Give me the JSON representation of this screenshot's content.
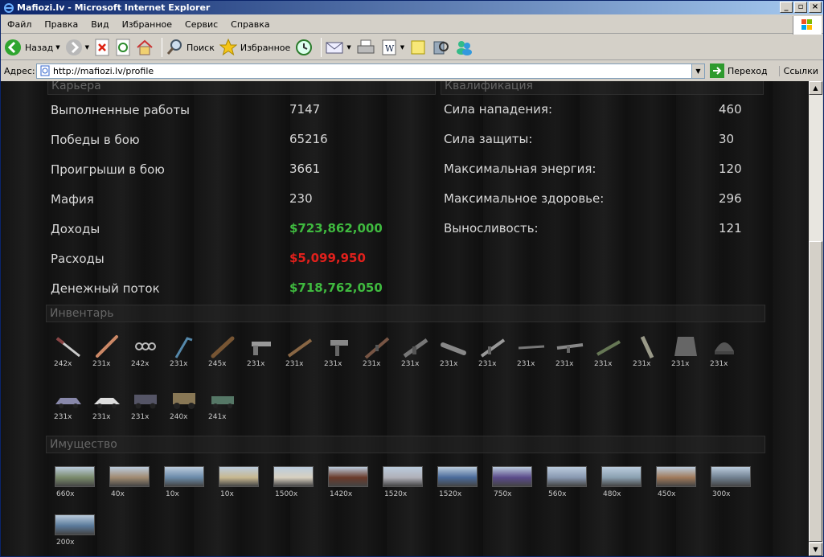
{
  "window": {
    "title": "Mafiozi.lv - Microsoft Internet Explorer"
  },
  "menu": [
    "Файл",
    "Правка",
    "Вид",
    "Избранное",
    "Сервис",
    "Справка"
  ],
  "toolbar": {
    "back_label": "Назад",
    "search_label": "Поиск",
    "favorites_label": "Избранное"
  },
  "address": {
    "label": "Адрес:",
    "url": "http://mafiozi.lv/profile",
    "go_label": "Переход",
    "links_label": "Ссылки"
  },
  "career": {
    "header": "Карьера",
    "rows": [
      {
        "label": "Выполненные работы",
        "value": "7147"
      },
      {
        "label": "Победы в бою",
        "value": "65216"
      },
      {
        "label": "Проигрыши в бою",
        "value": "3661"
      },
      {
        "label": "Мафия",
        "value": "230"
      },
      {
        "label": "Доходы",
        "value": "$723,862,000",
        "color": "#3fba3f"
      },
      {
        "label": "Расходы",
        "value": "$5,099,950",
        "color": "#e0201c"
      },
      {
        "label": "Денежный поток",
        "value": "$718,762,050",
        "color": "#3fba3f"
      }
    ]
  },
  "qualification": {
    "header": "Квалификация",
    "rows": [
      {
        "label": "Сила нападения:",
        "value": "460"
      },
      {
        "label": "Сила защиты:",
        "value": "30"
      },
      {
        "label": "Максимальная энергия:",
        "value": "120"
      },
      {
        "label": "Максимальное здоровье:",
        "value": "296"
      },
      {
        "label": "Выносливость:",
        "value": "121"
      }
    ]
  },
  "inventory": {
    "header": "Инвентарь",
    "items": [
      {
        "icon": "butterfly-knife-icon",
        "count": "242x"
      },
      {
        "icon": "baseball-bat-icon",
        "count": "231x"
      },
      {
        "icon": "brass-knuckles-icon",
        "count": "242x"
      },
      {
        "icon": "crowbar-icon",
        "count": "231x"
      },
      {
        "icon": "club-icon",
        "count": "245x"
      },
      {
        "icon": "pistol-icon",
        "count": "231x"
      },
      {
        "icon": "shotgun-icon",
        "count": "231x"
      },
      {
        "icon": "uzi-icon",
        "count": "231x"
      },
      {
        "icon": "rifle-icon",
        "count": "231x"
      },
      {
        "icon": "assault-rifle-icon",
        "count": "231x"
      },
      {
        "icon": "grenade-launcher-icon",
        "count": "231x"
      },
      {
        "icon": "submachine-gun-icon",
        "count": "231x"
      },
      {
        "icon": "sniper-rifle-icon",
        "count": "231x"
      },
      {
        "icon": "light-machine-gun-icon",
        "count": "231x"
      },
      {
        "icon": "heavy-rifle-icon",
        "count": "231x"
      },
      {
        "icon": "holster-icon",
        "count": "231x"
      },
      {
        "icon": "body-armor-icon",
        "count": "231x"
      },
      {
        "icon": "helmet-icon",
        "count": "231x"
      },
      {
        "icon": "sedan-car-icon",
        "count": "231x"
      },
      {
        "icon": "sports-car-icon",
        "count": "231x"
      },
      {
        "icon": "suv-car-icon",
        "count": "231x"
      },
      {
        "icon": "hummer-car-icon",
        "count": "240x"
      },
      {
        "icon": "jeep-car-icon",
        "count": "241x"
      }
    ]
  },
  "property": {
    "header": "Имущество",
    "items": [
      {
        "icon": "house-photo-icon",
        "count": "660x"
      },
      {
        "icon": "apartment-photo-icon",
        "count": "40x"
      },
      {
        "icon": "office-photo-icon",
        "count": "10x"
      },
      {
        "icon": "beach-photo-icon",
        "count": "10x"
      },
      {
        "icon": "villa-photo-icon",
        "count": "1500x"
      },
      {
        "icon": "restaurant-photo-icon",
        "count": "1420x"
      },
      {
        "icon": "skyscraper-photo-icon",
        "count": "1520x"
      },
      {
        "icon": "hotel-photo-icon",
        "count": "1520x"
      },
      {
        "icon": "casino-photo-icon",
        "count": "750x"
      },
      {
        "icon": "tower-photo-icon",
        "count": "560x"
      },
      {
        "icon": "resort-photo-icon",
        "count": "480x"
      },
      {
        "icon": "palace-photo-icon",
        "count": "450x"
      },
      {
        "icon": "port-photo-icon",
        "count": "300x"
      },
      {
        "icon": "city-photo-icon",
        "count": "200x"
      }
    ]
  }
}
